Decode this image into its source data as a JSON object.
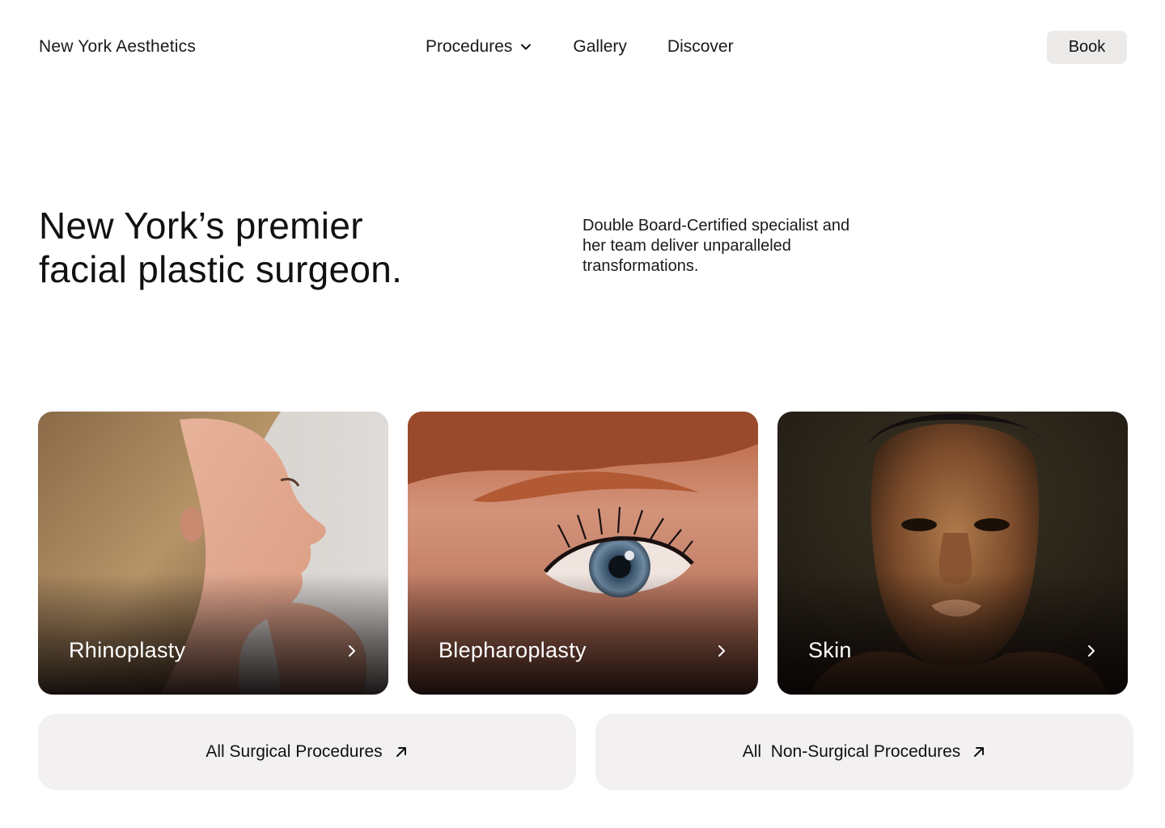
{
  "header": {
    "brand": "New York Aesthetics",
    "nav": [
      {
        "label": "Procedures",
        "icon": "chevron-down-icon"
      },
      {
        "label": "Gallery"
      },
      {
        "label": "Discover"
      }
    ],
    "book_label": "Book"
  },
  "hero": {
    "title_line1": "New York’s premier",
    "title_line2": "facial plastic surgeon.",
    "subtitle": "Double Board-Certified specialist and her team deliver unparalleled transformations."
  },
  "cards": [
    {
      "label": "Rhinoplasty",
      "icon": "chevron-right-icon"
    },
    {
      "label": "Blepharoplasty",
      "icon": "chevron-right-icon"
    },
    {
      "label": "Skin",
      "icon": "chevron-right-icon"
    }
  ],
  "cta": [
    {
      "label": "All Surgical Procedures",
      "icon": "arrow-up-right-icon"
    },
    {
      "label": "All  Non-Surgical Procedures",
      "icon": "arrow-up-right-icon"
    }
  ],
  "colors": {
    "book_bg": "#ebeae9",
    "cta_bg": "#f2f0f0",
    "text": "#111111"
  }
}
